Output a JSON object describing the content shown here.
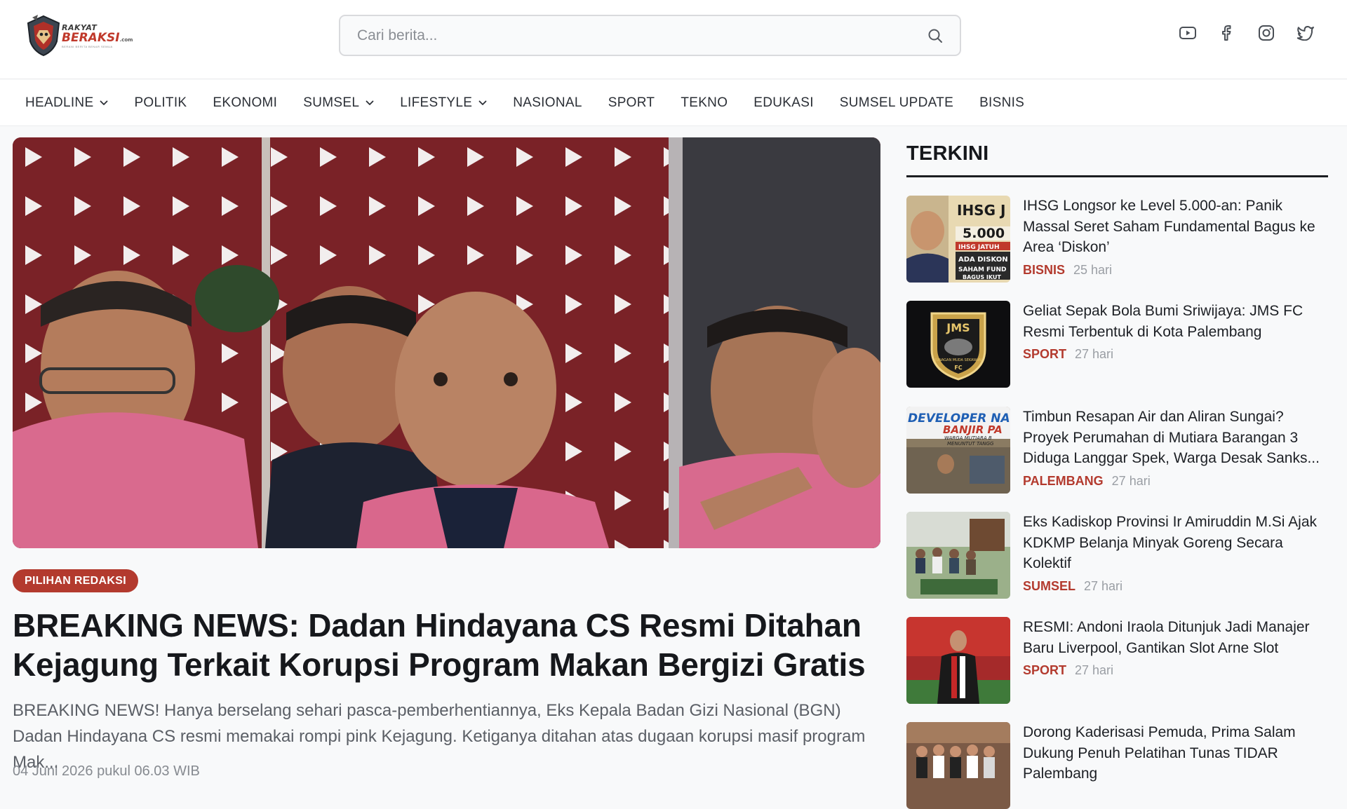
{
  "brand": {
    "line1": "RAKYAT",
    "line2": "BERAKSI",
    "suffix": ".com",
    "tagline": "BERANI BERITA BENAR SEMUA"
  },
  "search": {
    "placeholder": "Cari berita..."
  },
  "socials": [
    "youtube-icon",
    "facebook-icon",
    "instagram-icon",
    "twitter-icon"
  ],
  "nav": [
    {
      "label": "HEADLINE",
      "dropdown": true
    },
    {
      "label": "POLITIK",
      "dropdown": false
    },
    {
      "label": "EKONOMI",
      "dropdown": false
    },
    {
      "label": "SUMSEL",
      "dropdown": true
    },
    {
      "label": "LIFESTYLE",
      "dropdown": true
    },
    {
      "label": "NASIONAL",
      "dropdown": false
    },
    {
      "label": "SPORT",
      "dropdown": false
    },
    {
      "label": "TEKNO",
      "dropdown": false
    },
    {
      "label": "EDUKASI",
      "dropdown": false
    },
    {
      "label": "SUMSEL UPDATE",
      "dropdown": false
    },
    {
      "label": "BISNIS",
      "dropdown": false
    }
  ],
  "hero": {
    "badge": "PILIHAN REDAKSI",
    "headline": "BREAKING NEWS: Dadan Hindayana CS Resmi Ditahan Kejagung Terkait Korupsi Program Makan Bergizi Gratis",
    "excerpt": "BREAKING NEWS! Hanya berselang sehari pasca-pemberhentiannya, Eks Kepala Badan Gizi Nasional (BGN) Dadan Hindayana CS resmi memakai rompi pink Kejagung. Ketiganya ditahan atas dugaan korupsi masif program Mak...",
    "date": "04 Juni 2026 pukul 06.03 WIB"
  },
  "sidebar": {
    "title": "TERKINI",
    "items": [
      {
        "title": "IHSG Longsor ke Level 5.000-an: Panik Massal Seret Saham Fundamental Bagus ke Area ‘Diskon’",
        "category": "BISNIS",
        "ago": "25 hari",
        "thumb_text": [
          "IHSG J",
          "5.000",
          "IHSG JATUH",
          "ADA DISKON",
          "SAHAM FUND",
          "BAGUS IKUT"
        ]
      },
      {
        "title": "Geliat Sepak Bola Bumi Sriwijaya: JMS FC Resmi Terbentuk di Kota Palembang",
        "category": "SPORT",
        "ago": "27 hari",
        "thumb_text": [
          "JMS",
          "JUNAGAN MUDA SEKAWAN",
          "FC"
        ]
      },
      {
        "title": "Timbun Resapan Air dan Aliran Sungai? Proyek Perumahan di Mutiara Barangan 3 Diduga Langgar Spek, Warga Desak Sanks...",
        "category": "PALEMBANG",
        "ago": "27 hari",
        "thumb_text": [
          "DEVELOPER NA",
          "BANJIR PA",
          "WARGA MUTIARA B",
          "MENUNTUT TANGG"
        ]
      },
      {
        "title": "Eks Kadiskop Provinsi Ir Amiruddin M.Si Ajak KDKMP Belanja Minyak Goreng Secara Kolektif",
        "category": "SUMSEL",
        "ago": "27 hari",
        "thumb_text": []
      },
      {
        "title": "RESMI: Andoni Iraola Ditunjuk Jadi Manajer Baru Liverpool, Gantikan Slot Arne Slot",
        "category": "SPORT",
        "ago": "27 hari",
        "thumb_text": []
      },
      {
        "title": "Dorong Kaderisasi Pemuda, Prima Salam Dukung Penuh Pelatihan Tunas TIDAR Palembang",
        "category": "",
        "ago": "",
        "thumb_text": []
      }
    ]
  },
  "colors": {
    "accent": "#b33a2e",
    "text": "#16181c",
    "muted": "#5b5f66"
  }
}
